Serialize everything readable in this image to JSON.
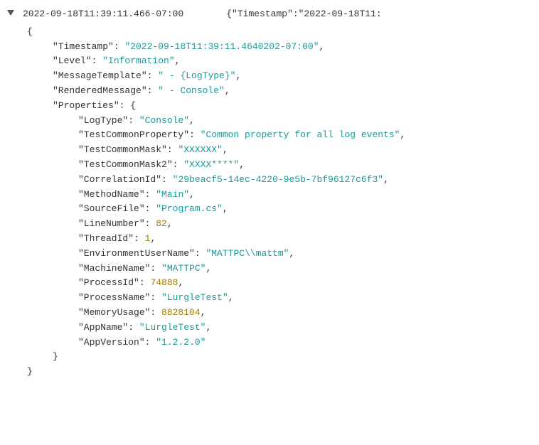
{
  "header": {
    "timestamp": "2022-09-18T11:39:11.466-07:00",
    "json_preview": "{\"Timestamp\":\"2022-09-18T11:"
  },
  "log": {
    "open_brace": "{",
    "close_brace": "}",
    "props_open": "{",
    "props_close": "}",
    "keys": {
      "Timestamp": "\"Timestamp\"",
      "Level": "\"Level\"",
      "MessageTemplate": "\"MessageTemplate\"",
      "RenderedMessage": "\"RenderedMessage\"",
      "Properties": "\"Properties\"",
      "LogType": "\"LogType\"",
      "TestCommonProperty": "\"TestCommonProperty\"",
      "TestCommonMask": "\"TestCommonMask\"",
      "TestCommonMask2": "\"TestCommonMask2\"",
      "CorrelationId": "\"CorrelationId\"",
      "MethodName": "\"MethodName\"",
      "SourceFile": "\"SourceFile\"",
      "LineNumber": "\"LineNumber\"",
      "ThreadId": "\"ThreadId\"",
      "EnvironmentUserName": "\"EnvironmentUserName\"",
      "MachineName": "\"MachineName\"",
      "ProcessId": "\"ProcessId\"",
      "ProcessName": "\"ProcessName\"",
      "MemoryUsage": "\"MemoryUsage\"",
      "AppName": "\"AppName\"",
      "AppVersion": "\"AppVersion\""
    },
    "values": {
      "Timestamp": "\"2022-09-18T11:39:11.4640202-07:00\"",
      "Level": "\"Information\"",
      "MessageTemplate": "\" - {LogType}\"",
      "RenderedMessage": "\" - Console\"",
      "LogType": "\"Console\"",
      "TestCommonProperty": "\"Common property for all log events\"",
      "TestCommonMask": "\"XXXXXX\"",
      "TestCommonMask2": "\"XXXX****\"",
      "CorrelationId": "\"29beacf5-14ec-4220-9e5b-7bf96127c6f3\"",
      "MethodName": "\"Main\"",
      "SourceFile": "\"Program.cs\"",
      "LineNumber": "82",
      "ThreadId": "1",
      "EnvironmentUserName": "\"MATTPC\\\\mattm\"",
      "MachineName": "\"MATTPC\"",
      "ProcessId": "74888",
      "ProcessName": "\"LurgleTest\"",
      "MemoryUsage": "8828104",
      "AppName": "\"LurgleTest\"",
      "AppVersion": "\"1.2.2.0\""
    },
    "colon": ": ",
    "comma": ","
  }
}
